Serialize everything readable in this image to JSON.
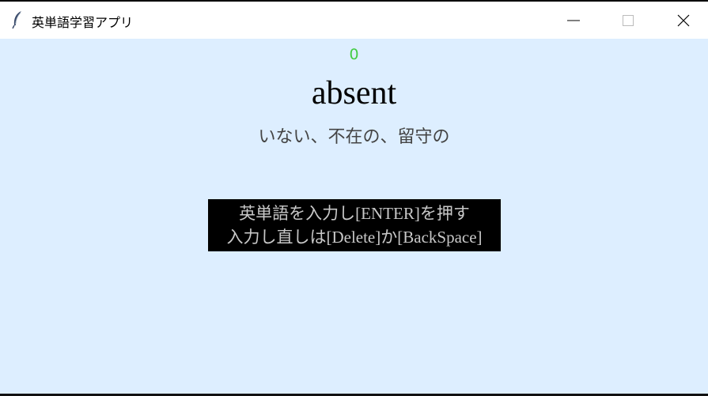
{
  "window": {
    "title": "英単語学習アプリ",
    "icon": "feather-icon",
    "buttons": [
      "minimize-icon",
      "maximize-icon",
      "close-icon"
    ]
  },
  "quiz": {
    "count": "0",
    "word": "absent",
    "meaning": "いない、不在の、留守の",
    "instruction_line1": "英単語を入力し[ENTER]を押す",
    "instruction_line2": "入力し直しは[Delete]か[BackSpace]"
  },
  "colors": {
    "background": "#ddeeff",
    "counter": "#44cc44",
    "instruction_bg": "#000000",
    "instruction_text": "#c8c8c8"
  }
}
